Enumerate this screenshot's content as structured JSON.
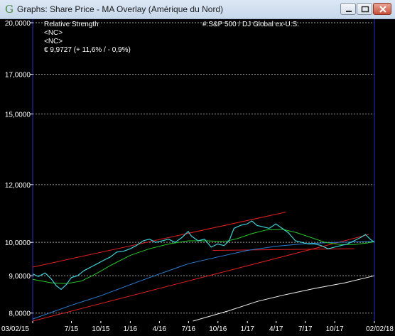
{
  "window": {
    "title": "Graphs: Share Price - MA Overlay (Amérique du Nord)",
    "icon": "g-app-icon"
  },
  "chart_data": {
    "type": "line",
    "legend": {
      "left_lines": [
        "Relative Strength",
        "<NC>",
        "<NC>",
        "€ 9,9727 (+ 11,6% / - 0,9%)"
      ],
      "right_line": "#:S&P 500 / DJ Global ex-U.S."
    },
    "yscale": "log",
    "ylim": [
      7800,
      20000
    ],
    "yticks": [
      {
        "value": 20000,
        "label": "20,0000"
      },
      {
        "value": 17000,
        "label": "17,0000"
      },
      {
        "value": 15000,
        "label": "15,0000"
      },
      {
        "value": 12000,
        "label": "12,0000"
      },
      {
        "value": 10000,
        "label": "10,0000"
      },
      {
        "value": 9000,
        "label": "9,0000"
      },
      {
        "value": 8000,
        "label": "8,0000"
      }
    ],
    "xlim": [
      "2015-03-02",
      "2018-02-02"
    ],
    "xticks": [
      {
        "value": "2015-03-02",
        "label": "03/02/15"
      },
      {
        "value": "2015-07-01",
        "label": "7/15"
      },
      {
        "value": "2015-10-01",
        "label": "10/15"
      },
      {
        "value": "2016-01-01",
        "label": "1/16"
      },
      {
        "value": "2016-04-01",
        "label": "4/16"
      },
      {
        "value": "2016-07-01",
        "label": "7/16"
      },
      {
        "value": "2016-10-01",
        "label": "10/16"
      },
      {
        "value": "2017-01-01",
        "label": "1/17"
      },
      {
        "value": "2017-04-01",
        "label": "4/17"
      },
      {
        "value": "2017-07-01",
        "label": "7/17"
      },
      {
        "value": "2017-10-01",
        "label": "10/17"
      },
      {
        "value": "2018-02-02",
        "label": "02/02/18"
      }
    ],
    "grid": "horizontal dashed",
    "colors": {
      "background": "#000000",
      "price": "#3fd0d8",
      "ma_short": "#28c828",
      "ma_medium": "#2a7fd6",
      "ma_long": "#f0f0f0",
      "trend": "#e0201e",
      "frame": "#2a2ad0",
      "grid": "#c8c8c8"
    },
    "series": [
      {
        "role": "price",
        "points": [
          [
            "2015-03-02",
            9050
          ],
          [
            "2015-03-20",
            8980
          ],
          [
            "2015-04-10",
            9080
          ],
          [
            "2015-04-30",
            8900
          ],
          [
            "2015-05-15",
            8720
          ],
          [
            "2015-05-30",
            8620
          ],
          [
            "2015-06-15",
            8750
          ],
          [
            "2015-07-01",
            8950
          ],
          [
            "2015-07-20",
            9000
          ],
          [
            "2015-08-10",
            9150
          ],
          [
            "2015-08-31",
            9250
          ],
          [
            "2015-09-20",
            9350
          ],
          [
            "2015-10-10",
            9450
          ],
          [
            "2015-10-31",
            9550
          ],
          [
            "2015-11-20",
            9700
          ],
          [
            "2015-12-10",
            9720
          ],
          [
            "2016-01-01",
            9800
          ],
          [
            "2016-01-20",
            9900
          ],
          [
            "2016-02-10",
            10050
          ],
          [
            "2016-03-01",
            10100
          ],
          [
            "2016-03-20",
            10000
          ],
          [
            "2016-04-10",
            10050
          ],
          [
            "2016-04-30",
            10100
          ],
          [
            "2016-05-20",
            10000
          ],
          [
            "2016-06-10",
            10150
          ],
          [
            "2016-06-30",
            10350
          ],
          [
            "2016-07-10",
            10200
          ],
          [
            "2016-07-31",
            10050
          ],
          [
            "2016-08-20",
            10100
          ],
          [
            "2016-09-10",
            9850
          ],
          [
            "2016-09-30",
            9950
          ],
          [
            "2016-10-20",
            9900
          ],
          [
            "2016-11-05",
            10050
          ],
          [
            "2016-11-20",
            10450
          ],
          [
            "2016-12-10",
            10550
          ],
          [
            "2016-12-31",
            10600
          ],
          [
            "2017-01-15",
            10700
          ],
          [
            "2017-01-31",
            10550
          ],
          [
            "2017-02-20",
            10500
          ],
          [
            "2017-03-10",
            10450
          ],
          [
            "2017-03-31",
            10600
          ],
          [
            "2017-04-20",
            10450
          ],
          [
            "2017-05-10",
            10300
          ],
          [
            "2017-05-31",
            10050
          ],
          [
            "2017-06-20",
            10000
          ],
          [
            "2017-07-10",
            9950
          ],
          [
            "2017-07-31",
            9950
          ],
          [
            "2017-08-20",
            9900
          ],
          [
            "2017-09-10",
            9800
          ],
          [
            "2017-09-30",
            9850
          ],
          [
            "2017-10-20",
            9900
          ],
          [
            "2017-11-10",
            9950
          ],
          [
            "2017-11-30",
            10050
          ],
          [
            "2017-12-20",
            10150
          ],
          [
            "2018-01-05",
            10250
          ],
          [
            "2018-01-20",
            10100
          ],
          [
            "2018-02-02",
            10000
          ]
        ]
      },
      {
        "role": "ma_short",
        "points": [
          [
            "2015-03-02",
            8900
          ],
          [
            "2015-05-01",
            8800
          ],
          [
            "2015-06-15",
            8780
          ],
          [
            "2015-08-01",
            8850
          ],
          [
            "2015-09-15",
            9050
          ],
          [
            "2015-11-01",
            9300
          ],
          [
            "2016-01-01",
            9600
          ],
          [
            "2016-03-01",
            9800
          ],
          [
            "2016-05-01",
            9950
          ],
          [
            "2016-07-01",
            10050
          ],
          [
            "2016-09-01",
            10050
          ],
          [
            "2016-10-20",
            10020
          ],
          [
            "2016-12-01",
            10120
          ],
          [
            "2017-01-15",
            10280
          ],
          [
            "2017-03-01",
            10400
          ],
          [
            "2017-04-20",
            10420
          ],
          [
            "2017-06-01",
            10320
          ],
          [
            "2017-07-20",
            10150
          ],
          [
            "2017-09-01",
            10000
          ],
          [
            "2017-10-20",
            9930
          ],
          [
            "2017-12-01",
            9930
          ],
          [
            "2018-01-10",
            9980
          ],
          [
            "2018-02-02",
            10020
          ]
        ]
      },
      {
        "role": "ma_medium",
        "points": [
          [
            "2015-03-02",
            7850
          ],
          [
            "2015-07-01",
            8200
          ],
          [
            "2015-10-01",
            8450
          ],
          [
            "2016-01-01",
            8750
          ],
          [
            "2016-04-01",
            9050
          ],
          [
            "2016-07-01",
            9350
          ],
          [
            "2016-10-01",
            9550
          ],
          [
            "2017-01-01",
            9750
          ],
          [
            "2017-04-01",
            9880
          ],
          [
            "2017-07-01",
            9960
          ],
          [
            "2017-10-01",
            10000
          ],
          [
            "2018-02-02",
            10030
          ]
        ]
      },
      {
        "role": "ma_long",
        "points": [
          [
            "2016-07-15",
            7800
          ],
          [
            "2016-11-01",
            8050
          ],
          [
            "2017-02-01",
            8300
          ],
          [
            "2017-05-01",
            8480
          ],
          [
            "2017-08-01",
            8650
          ],
          [
            "2017-11-01",
            8800
          ],
          [
            "2018-02-02",
            9000
          ]
        ]
      }
    ],
    "trendlines": [
      {
        "from": [
          "2015-03-02",
          9250
        ],
        "to": [
          "2017-05-01",
          11000
        ]
      },
      {
        "from": [
          "2015-03-02",
          7800
        ],
        "to": [
          "2018-01-15",
          10250
        ]
      },
      {
        "from": [
          "2016-09-15",
          9750
        ],
        "to": [
          "2017-12-01",
          9800
        ]
      }
    ]
  }
}
